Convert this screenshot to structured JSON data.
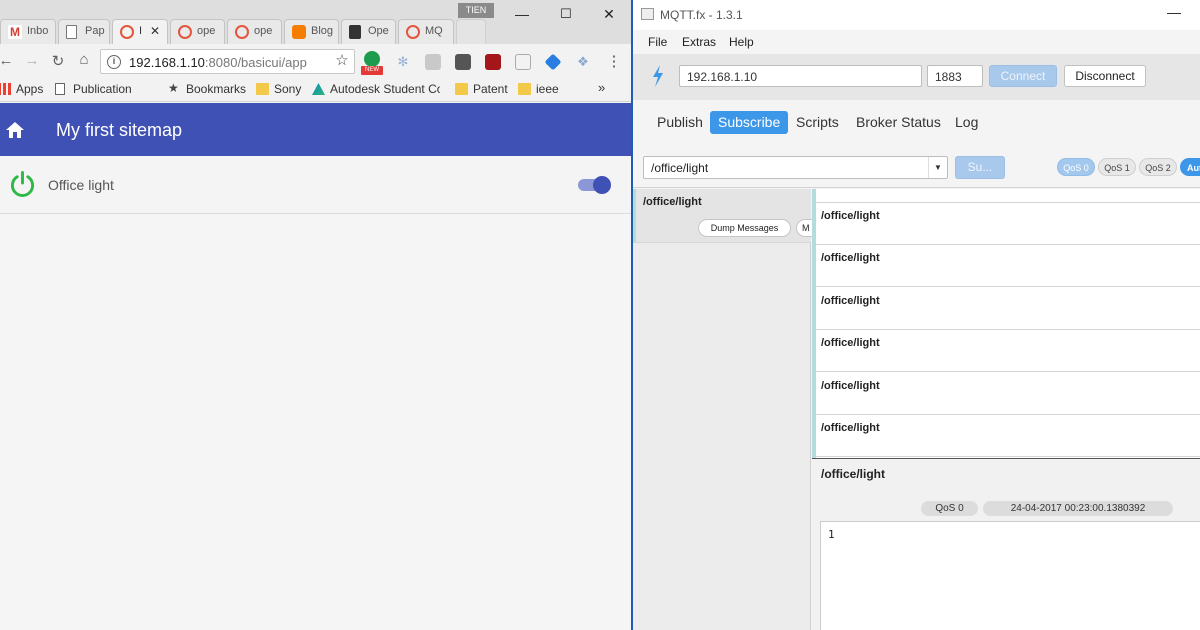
{
  "chrome": {
    "tabs": [
      {
        "label": "Inbo",
        "icon": "gmail-icon"
      },
      {
        "label": "Pap",
        "icon": "page-icon"
      },
      {
        "label": "I",
        "icon": "openhab-icon"
      },
      {
        "label": "ope",
        "icon": "openhab-icon"
      },
      {
        "label": "ope",
        "icon": "openhab-icon"
      },
      {
        "label": "Blog",
        "icon": "blogger-icon"
      },
      {
        "label": "Ope",
        "icon": "book-icon"
      },
      {
        "label": "MQ",
        "icon": "openhab-icon"
      }
    ],
    "profile_label": "TIEN",
    "url_host": "192.168.1.10",
    "url_rest": ":8080/basicui/app",
    "extension_badge": "NEW",
    "bookmarks": [
      {
        "label": "Apps",
        "icon": "apps-grid-icon"
      },
      {
        "label": "Publication",
        "icon": "page-icon"
      },
      {
        "label": "Bookmarks",
        "icon": "star-icon"
      },
      {
        "label": "Sony",
        "icon": "folder-icon"
      },
      {
        "label": "Autodesk Student Cor",
        "icon": "autodesk-icon"
      },
      {
        "label": "Patent",
        "icon": "folder-icon"
      },
      {
        "label": "ieee",
        "icon": "folder-icon"
      }
    ]
  },
  "openhab": {
    "title": "My first sitemap",
    "item_label": "Office light",
    "switch_on": true,
    "header_color": "#3f51b5",
    "power_color": "#2eb845"
  },
  "mqtt": {
    "window_title": "MQTT.fx - 1.3.1",
    "menu": [
      "File",
      "Extras",
      "Help"
    ],
    "broker_address": "192.168.1.10",
    "broker_port": "1883",
    "connect_label": "Connect",
    "disconnect_label": "Disconnect",
    "tabs": [
      "Publish",
      "Subscribe",
      "Scripts",
      "Broker Status",
      "Log"
    ],
    "active_tab": "Subscribe",
    "subscribe_topic": "/office/light",
    "subscribe_button": "Su...",
    "qos_options": [
      "QoS 0",
      "QoS 1",
      "QoS 2"
    ],
    "autoscroll_label": "Aut",
    "topic_list": [
      {
        "name": "/office/light",
        "dump_label": "Dump Messages",
        "extra_label": "M"
      }
    ],
    "messages": [
      "/office/light",
      "/office/light",
      "/office/light",
      "/office/light",
      "/office/light",
      "/office/light"
    ],
    "detail": {
      "topic": "/office/light",
      "qos": "QoS 0",
      "timestamp": "24-04-2017  00:23:00.1380392",
      "payload": "1"
    },
    "accent_color": "#3d97e8"
  }
}
